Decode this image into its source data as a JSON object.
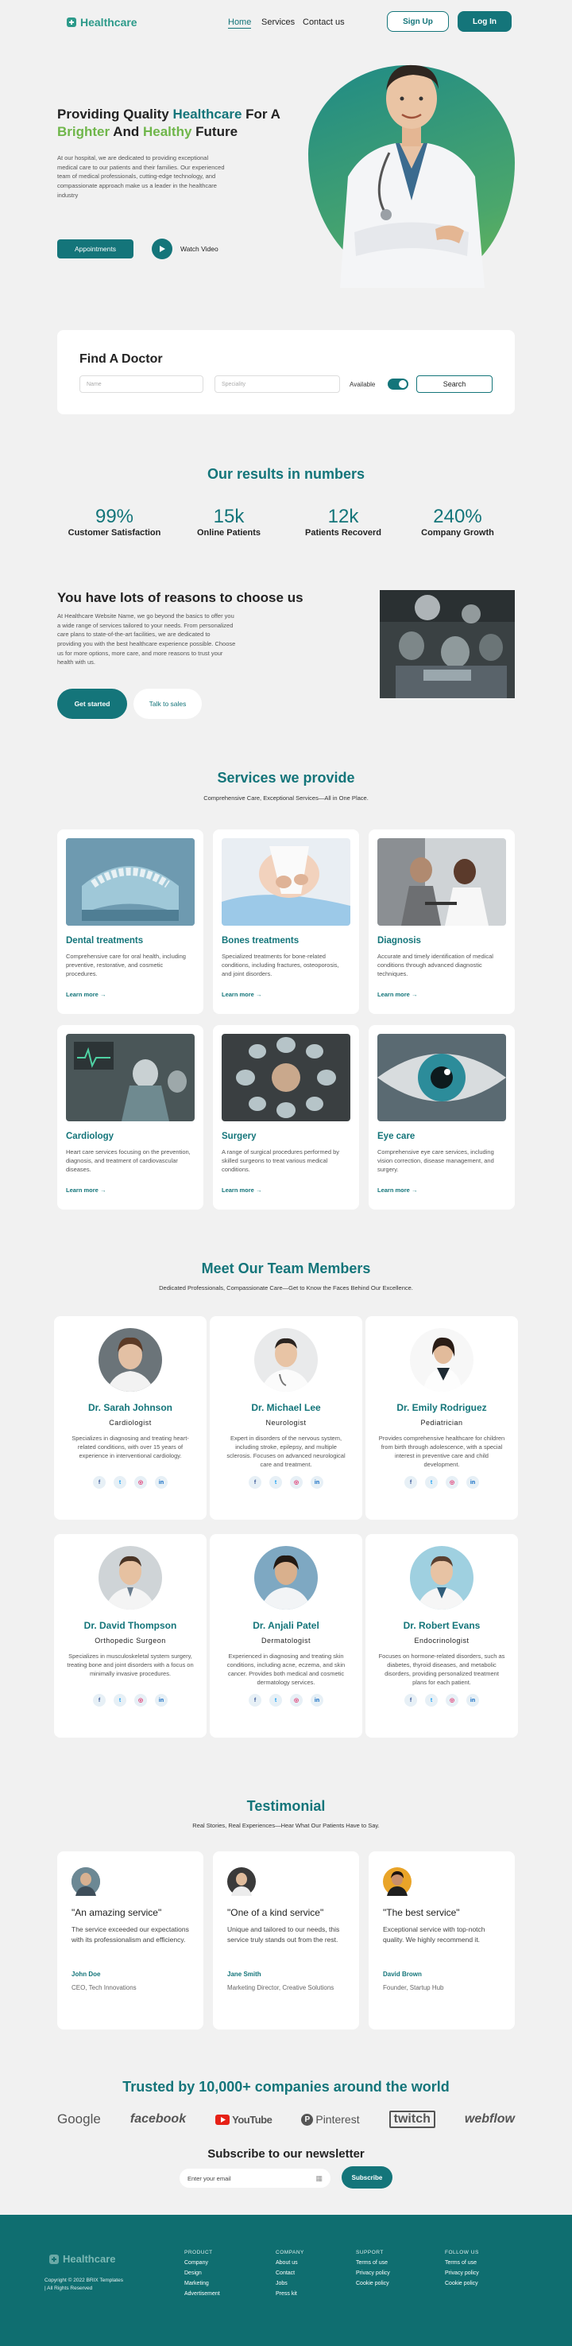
{
  "nav": {
    "logo": "Healthcare",
    "links": [
      "Home",
      "Services",
      "Contact us"
    ],
    "signup": "Sign Up",
    "login": "Log In"
  },
  "hero": {
    "title_p1": "Providing Quality ",
    "title_hl1": "Healthcare",
    "title_p2": " For A",
    "title_hl2": "Brighter",
    "title_p3": " And ",
    "title_hl3": "Healthy",
    "title_p4": " Future",
    "desc": "At our hospital, we are dedicated to providing exceptional medical care to our patients and their families. Our experienced team of medical professionals, cutting-edge technology, and compassionate approach make us a leader in the healthcare industry",
    "btn_primary": "Appointments",
    "btn_video": "Watch Video"
  },
  "find": {
    "title": "Find A Doctor",
    "name_placeholder": "Name",
    "speciality_placeholder": "Speciality",
    "available": "Available",
    "search": "Search"
  },
  "results": {
    "title": "Our results in numbers",
    "stats": [
      {
        "num": "99%",
        "label": "Customer Satisfaction"
      },
      {
        "num": "15k",
        "label": "Online Patients"
      },
      {
        "num": "12k",
        "label": "Patients Recoverd"
      },
      {
        "num": "240%",
        "label": "Company Growth"
      }
    ]
  },
  "reasons": {
    "title": "You have lots of reasons to choose us",
    "desc": "At Healthcare Website Name, we go beyond the basics to offer you a wide range of services tailored to your needs. From personalized care plans to state-of-the-art facilities, we are dedicated to providing you with the best healthcare experience possible. Choose us for more options, more care, and more reasons to trust your health with us.",
    "btn_primary": "Get started",
    "btn_secondary": "Talk to sales"
  },
  "services": {
    "title": "Services we provide",
    "subtitle": "Comprehensive Care, Exceptional Services—All in One Place.",
    "learn_more": "Learn more",
    "items": [
      {
        "title": "Dental treatments",
        "desc": "Comprehensive care for oral health, including preventive, restorative, and cosmetic procedures."
      },
      {
        "title": "Bones treatments",
        "desc": "Specialized treatments for bone-related conditions, including fractures, osteoporosis, and joint disorders."
      },
      {
        "title": "Diagnosis",
        "desc": "Accurate and timely identification of medical conditions through advanced diagnostic techniques."
      },
      {
        "title": "Cardiology",
        "desc": "Heart care services focusing on the prevention, diagnosis, and treatment of cardiovascular diseases."
      },
      {
        "title": "Surgery",
        "desc": "A range of surgical procedures performed by skilled surgeons to treat various medical conditions."
      },
      {
        "title": "Eye care",
        "desc": "Comprehensive eye care services, including vision correction, disease management, and surgery."
      }
    ]
  },
  "team": {
    "title": "Meet Our Team Members",
    "subtitle": "Dedicated Professionals, Compassionate Care—Get to Know the Faces Behind Our Excellence.",
    "members": [
      {
        "name": "Dr. Sarah Johnson",
        "role": "Cardiologist",
        "desc": "Specializes in diagnosing and treating heart-related conditions, with over 15 years of experience in interventional cardiology."
      },
      {
        "name": "Dr. Michael Lee",
        "role": "Neurologist",
        "desc": "Expert in disorders of the nervous system, including stroke, epilepsy, and multiple sclerosis. Focuses on advanced neurological care and treatment."
      },
      {
        "name": "Dr. Emily Rodriguez",
        "role": "Pediatrician",
        "desc": "Provides comprehensive healthcare for children from birth through adolescence, with a special interest in preventive care and child development."
      },
      {
        "name": "Dr. David Thompson",
        "role": "Orthopedic Surgeon",
        "desc": "Specializes in musculoskeletal system surgery, treating bone and joint disorders with a focus on minimally invasive procedures."
      },
      {
        "name": "Dr. Anjali Patel",
        "role": "Dermatologist",
        "desc": "Experienced in diagnosing and treating skin conditions, including acne, eczema, and skin cancer. Provides both medical and cosmetic dermatology services."
      },
      {
        "name": "Dr. Robert Evans",
        "role": "Endocrinologist",
        "desc": "Focuses on hormone-related disorders, such as diabetes, thyroid diseases, and metabolic disorders, providing personalized treatment plans for each patient."
      }
    ]
  },
  "testimonial": {
    "title": "Testimonial",
    "subtitle": "Real Stories, Real Experiences—Hear What Our Patients Have to Say.",
    "items": [
      {
        "quote": "\"An amazing service\"",
        "body": "The service exceeded our expectations with its professionalism and efficiency.",
        "name": "John Doe",
        "role": "CEO, Tech Innovations"
      },
      {
        "quote": "\"One of a kind service\"",
        "body": "Unique and tailored to our needs, this service truly stands out from the rest.",
        "name": "Jane Smith",
        "role": "Marketing Director, Creative Solutions"
      },
      {
        "quote": "\"The best service\"",
        "body": "Exceptional service with top-notch quality. We highly recommend it.",
        "name": "David Brown",
        "role": "Founder, Startup Hub"
      }
    ]
  },
  "trusted": {
    "title": "Trusted by 10,000+ companies around the world",
    "brands": [
      "Google",
      "facebook",
      "YouTube",
      "Pinterest",
      "twitch",
      "webflow"
    ]
  },
  "newsletter": {
    "title": "Subscribe to our newsletter",
    "placeholder": "Enter your email",
    "button": "Subscribe"
  },
  "footer": {
    "logo": "Healthcare",
    "copyright": "Copyright © 2022 BRIX Templates",
    "rights": "| All Rights Reserved",
    "cols": [
      {
        "head": "PRODUCT",
        "links": [
          "Company",
          "Design",
          "Marketing",
          "Advertisement"
        ]
      },
      {
        "head": "COMPANY",
        "links": [
          "About us",
          "Contact",
          "Jobs",
          "Press kit"
        ]
      },
      {
        "head": "SUPPORT",
        "links": [
          "Terms of use",
          "Privacy policy",
          "Cookie policy"
        ]
      },
      {
        "head": "FOLLOW US",
        "links": [
          "Terms of use",
          "Privacy policy",
          "Cookie policy"
        ]
      }
    ]
  },
  "colors": {
    "primary": "#14757a",
    "accent": "#6fb64a",
    "footer": "#0f6e70"
  }
}
